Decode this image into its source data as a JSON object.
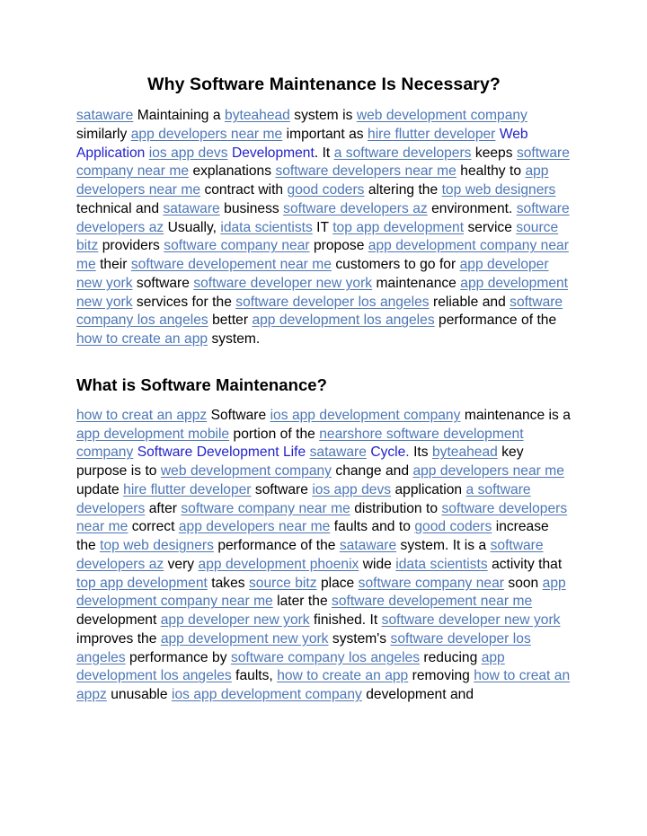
{
  "document": {
    "title": "Why Software Maintenance Is Necessary?",
    "colors": {
      "link": "#4d77b6",
      "navy_text": "#2222cc",
      "body_text": "#000000",
      "background": "#ffffff"
    },
    "sections": [
      {
        "heading": "Why Software Maintenance Is Necessary?",
        "heading_align": "center",
        "paragraph_runs": [
          {
            "t": "sataware",
            "s": "link"
          },
          {
            "t": " Maintaining a ",
            "s": "plain"
          },
          {
            "t": "byteahead",
            "s": "link"
          },
          {
            "t": " system is ",
            "s": "plain"
          },
          {
            "t": "web development company",
            "s": "link"
          },
          {
            "t": " similarly ",
            "s": "plain"
          },
          {
            "t": "app developers near me",
            "s": "link"
          },
          {
            "t": " important as ",
            "s": "plain"
          },
          {
            "t": "hire flutter developer",
            "s": "link"
          },
          {
            "t": " ",
            "s": "plain"
          },
          {
            "t": "Web Application",
            "s": "navy"
          },
          {
            "t": " ",
            "s": "plain"
          },
          {
            "t": "ios app devs",
            "s": "link"
          },
          {
            "t": " ",
            "s": "plain"
          },
          {
            "t": "Development",
            "s": "navy"
          },
          {
            "t": ". It ",
            "s": "plain"
          },
          {
            "t": "a software developers",
            "s": "link"
          },
          {
            "t": " keeps ",
            "s": "plain"
          },
          {
            "t": "software company near me",
            "s": "link"
          },
          {
            "t": " explanations ",
            "s": "plain"
          },
          {
            "t": "software developers near me",
            "s": "link"
          },
          {
            "t": " healthy to ",
            "s": "plain"
          },
          {
            "t": "app developers near me",
            "s": "link"
          },
          {
            "t": " contract with ",
            "s": "plain"
          },
          {
            "t": "good coders",
            "s": "link"
          },
          {
            "t": " altering the ",
            "s": "plain"
          },
          {
            "t": "top web designers",
            "s": "link"
          },
          {
            "t": " technical and ",
            "s": "plain"
          },
          {
            "t": "sataware",
            "s": "link"
          },
          {
            "t": " business ",
            "s": "plain"
          },
          {
            "t": "software developers az",
            "s": "link"
          },
          {
            "t": " environment. ",
            "s": "plain"
          },
          {
            "t": "software developers az",
            "s": "link"
          },
          {
            "t": " Usually, ",
            "s": "plain"
          },
          {
            "t": "idata scientists",
            "s": "link"
          },
          {
            "t": " IT ",
            "s": "plain"
          },
          {
            "t": "top app development",
            "s": "link"
          },
          {
            "t": " service ",
            "s": "plain"
          },
          {
            "t": "source bitz",
            "s": "link"
          },
          {
            "t": " providers ",
            "s": "plain"
          },
          {
            "t": "software company near",
            "s": "link"
          },
          {
            "t": " propose ",
            "s": "plain"
          },
          {
            "t": "app development company near me",
            "s": "link"
          },
          {
            "t": " their ",
            "s": "plain"
          },
          {
            "t": "software developement near me",
            "s": "link"
          },
          {
            "t": " customers to go for ",
            "s": "plain"
          },
          {
            "t": "app developer new york",
            "s": "link"
          },
          {
            "t": " software ",
            "s": "plain"
          },
          {
            "t": "software developer new york",
            "s": "link"
          },
          {
            "t": " maintenance ",
            "s": "plain"
          },
          {
            "t": "app development new york",
            "s": "link"
          },
          {
            "t": " services for the ",
            "s": "plain"
          },
          {
            "t": "software developer los angeles",
            "s": "link"
          },
          {
            "t": " reliable and ",
            "s": "plain"
          },
          {
            "t": "software company los angeles",
            "s": "link"
          },
          {
            "t": " better ",
            "s": "plain"
          },
          {
            "t": "app development los angeles",
            "s": "link"
          },
          {
            "t": " performance of the ",
            "s": "plain"
          },
          {
            "t": "how to create an app",
            "s": "link"
          },
          {
            "t": " system.",
            "s": "plain"
          }
        ]
      },
      {
        "heading": "What is Software Maintenance?",
        "heading_align": "left",
        "paragraph_runs": [
          {
            "t": "how to creat an appz",
            "s": "link"
          },
          {
            "t": " Software ",
            "s": "plain"
          },
          {
            "t": "ios app development company",
            "s": "link"
          },
          {
            "t": " maintenance is a ",
            "s": "plain"
          },
          {
            "t": "app development mobile",
            "s": "link"
          },
          {
            "t": " portion of the ",
            "s": "plain"
          },
          {
            "t": "nearshore software development company",
            "s": "link"
          },
          {
            "t": " ",
            "s": "plain"
          },
          {
            "t": "Software Development Life",
            "s": "navy"
          },
          {
            "t": " ",
            "s": "plain"
          },
          {
            "t": "sataware",
            "s": "link"
          },
          {
            "t": " ",
            "s": "plain"
          },
          {
            "t": "Cycle.",
            "s": "navy"
          },
          {
            "t": " Its ",
            "s": "plain"
          },
          {
            "t": "byteahead",
            "s": "link"
          },
          {
            "t": " key purpose is to ",
            "s": "plain"
          },
          {
            "t": "web development company",
            "s": "link"
          },
          {
            "t": " change and ",
            "s": "plain"
          },
          {
            "t": "app developers near me",
            "s": "link"
          },
          {
            "t": " update ",
            "s": "plain"
          },
          {
            "t": "hire flutter developer",
            "s": "link"
          },
          {
            "t": " software ",
            "s": "plain"
          },
          {
            "t": "ios app devs",
            "s": "link"
          },
          {
            "t": " application ",
            "s": "plain"
          },
          {
            "t": "a software developers",
            "s": "link"
          },
          {
            "t": " after ",
            "s": "plain"
          },
          {
            "t": "software company near me",
            "s": "link"
          },
          {
            "t": " distribution to ",
            "s": "plain"
          },
          {
            "t": "software developers near me",
            "s": "link"
          },
          {
            "t": " correct ",
            "s": "plain"
          },
          {
            "t": "app developers near me",
            "s": "link"
          },
          {
            "t": " faults and to ",
            "s": "plain"
          },
          {
            "t": "good coders",
            "s": "link"
          },
          {
            "t": " increase the ",
            "s": "plain"
          },
          {
            "t": "top web designers",
            "s": "link"
          },
          {
            "t": " performance of the ",
            "s": "plain"
          },
          {
            "t": "sataware",
            "s": "link"
          },
          {
            "t": " system. It is a ",
            "s": "plain"
          },
          {
            "t": "software developers az",
            "s": "link"
          },
          {
            "t": " very ",
            "s": "plain"
          },
          {
            "t": "app development phoenix",
            "s": "link"
          },
          {
            "t": " wide ",
            "s": "plain"
          },
          {
            "t": "idata scientists",
            "s": "link"
          },
          {
            "t": " activity that ",
            "s": "plain"
          },
          {
            "t": "top app development",
            "s": "link"
          },
          {
            "t": " takes ",
            "s": "plain"
          },
          {
            "t": "source bitz",
            "s": "link"
          },
          {
            "t": " place ",
            "s": "plain"
          },
          {
            "t": "software company near",
            "s": "link"
          },
          {
            "t": " soon ",
            "s": "plain"
          },
          {
            "t": "app development company near me",
            "s": "link"
          },
          {
            "t": " later the ",
            "s": "plain"
          },
          {
            "t": "software developement near me",
            "s": "link"
          },
          {
            "t": " development ",
            "s": "plain"
          },
          {
            "t": "app developer new york",
            "s": "link"
          },
          {
            "t": " finished. It ",
            "s": "plain"
          },
          {
            "t": "software developer new york",
            "s": "link"
          },
          {
            "t": " improves the ",
            "s": "plain"
          },
          {
            "t": "app development new york",
            "s": "link"
          },
          {
            "t": " system's ",
            "s": "plain"
          },
          {
            "t": "software developer los angeles",
            "s": "link"
          },
          {
            "t": " performance by ",
            "s": "plain"
          },
          {
            "t": "software company los angeles",
            "s": "link"
          },
          {
            "t": " reducing ",
            "s": "plain"
          },
          {
            "t": "app development los angeles",
            "s": "link"
          },
          {
            "t": " faults, ",
            "s": "plain"
          },
          {
            "t": "how to create an app",
            "s": "link"
          },
          {
            "t": " removing ",
            "s": "plain"
          },
          {
            "t": "how to creat an appz",
            "s": "link"
          },
          {
            "t": " unusable ",
            "s": "plain"
          },
          {
            "t": "ios app development company",
            "s": "link"
          },
          {
            "t": " development and",
            "s": "plain"
          }
        ]
      }
    ]
  }
}
